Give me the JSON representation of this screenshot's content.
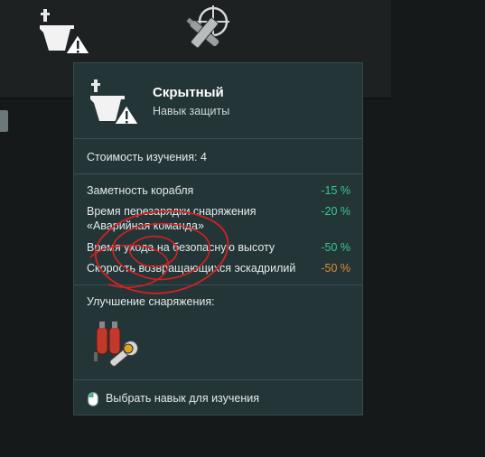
{
  "topbar": {
    "skill_icon": "carrier-concealment-warning-icon",
    "plane_icon": "plane-target-icon"
  },
  "tooltip": {
    "title": "Скрытный",
    "subtitle": "Навык защиты",
    "cost": "Стоимость изучения: 4",
    "stats": [
      {
        "label": "Заметность корабля",
        "value": "-15 %",
        "color": "#34c796"
      },
      {
        "label": "Время перезарядки снаряжения «Аварийная команда»",
        "value": "-20 %",
        "color": "#34c796"
      },
      {
        "label": "Время ухода на безопасную высоту",
        "value": "-50 %",
        "color": "#34c796"
      },
      {
        "label": "Скорость возвращающихся эскадрилий",
        "value": "-50 %",
        "color": "#e08a30"
      }
    ],
    "upgrade_label": "Улучшение снаряжения:",
    "footer": "Выбрать навык для изучения"
  }
}
